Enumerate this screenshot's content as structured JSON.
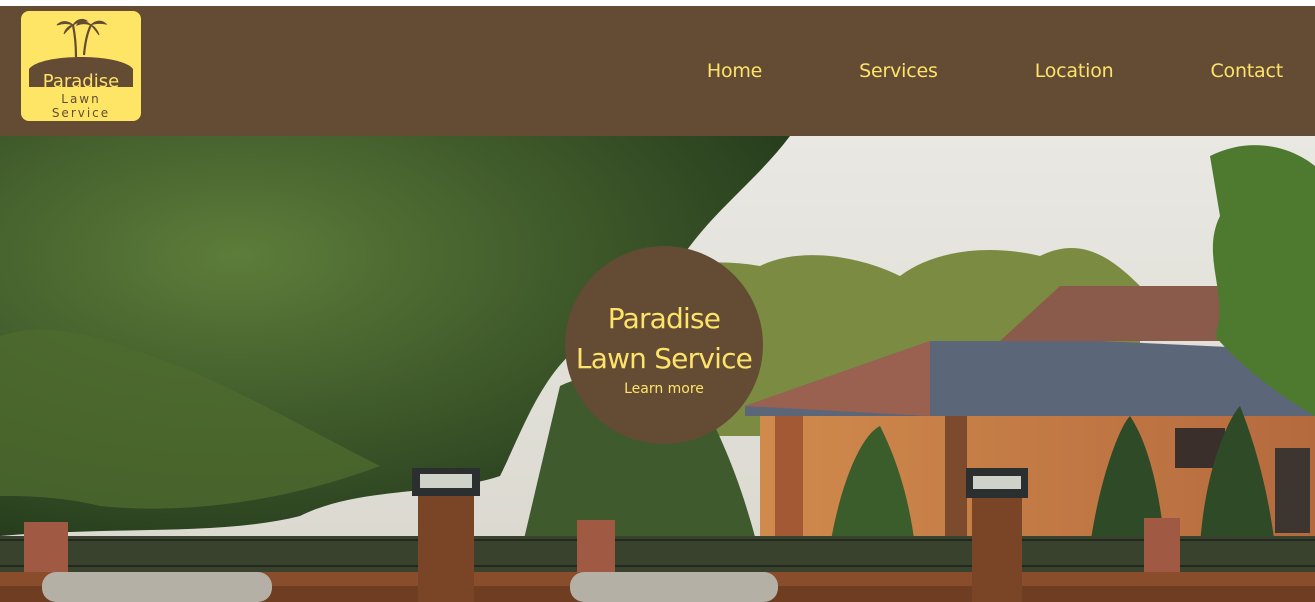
{
  "logo": {
    "line1": "Paradise",
    "line2": "Lawn",
    "line3": "Service",
    "icon": "palm-trees-icon"
  },
  "nav": {
    "items": [
      {
        "label": "Home"
      },
      {
        "label": "Services"
      },
      {
        "label": "Location"
      },
      {
        "label": "Contact"
      }
    ]
  },
  "hero": {
    "title_line1": "Paradise",
    "title_line2": "Lawn Service",
    "cta_label": "Learn more"
  },
  "colors": {
    "header_bg": "#634c33",
    "accent_yellow": "#fde36a",
    "logo_bg": "#ffe565"
  }
}
